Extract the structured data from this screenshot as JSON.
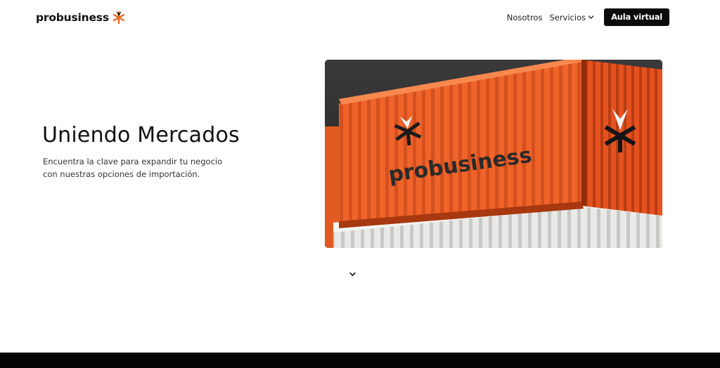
{
  "brand": {
    "name": "probusiness",
    "accent_color": "#f26a21",
    "logo_icon": "asterisk-star-icon"
  },
  "nav": {
    "items": [
      {
        "label": "Nosotros"
      },
      {
        "label": "Servicios",
        "icon": "chevron-down-icon"
      }
    ],
    "cta_label": "Aula virtual"
  },
  "hero": {
    "title": "Uniendo Mercados",
    "subtitle": "Encuentra la clave para expandir tu negocio con nuestras opciones de importación.",
    "image": {
      "subject": "orange shipping container stacked on a white container",
      "container_text": "probusiness"
    },
    "scroll_icon": "chevron-down-icon"
  }
}
